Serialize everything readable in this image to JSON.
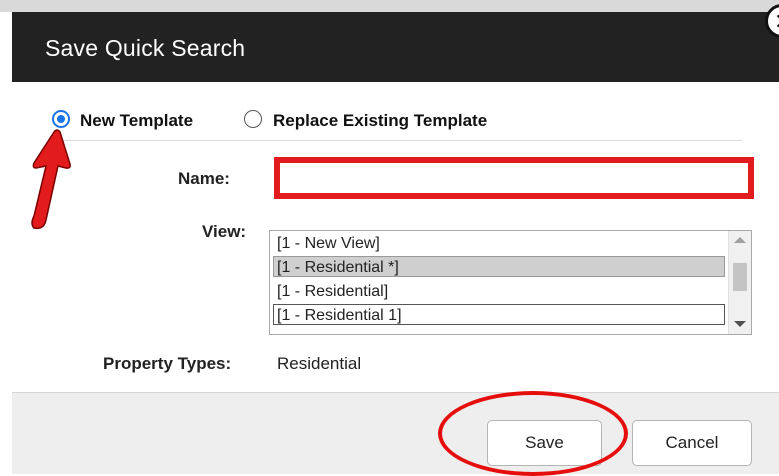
{
  "dialog": {
    "title": "Save Quick Search",
    "close_icon": "close-icon"
  },
  "template_mode": {
    "selected": "new",
    "options": [
      {
        "id": "new",
        "label": "New Template"
      },
      {
        "id": "replace",
        "label": "Replace Existing Template"
      }
    ]
  },
  "form": {
    "name_label": "Name:",
    "name_value": "",
    "view_label": "View:",
    "view_options": [
      "[1 - New View]",
      "[1 - Residential *]",
      "[1 - Residential]",
      "[1 - Residential 1]"
    ],
    "view_selected": "[1 - Residential *]",
    "property_types_label": "Property Types:",
    "property_types_value": "Residential"
  },
  "buttons": {
    "save_label": "Save",
    "cancel_label": "Cancel"
  },
  "colors": {
    "titlebar": "#222222",
    "radio_accent": "#1a73e8",
    "annotation_red": "#e21c1c"
  }
}
